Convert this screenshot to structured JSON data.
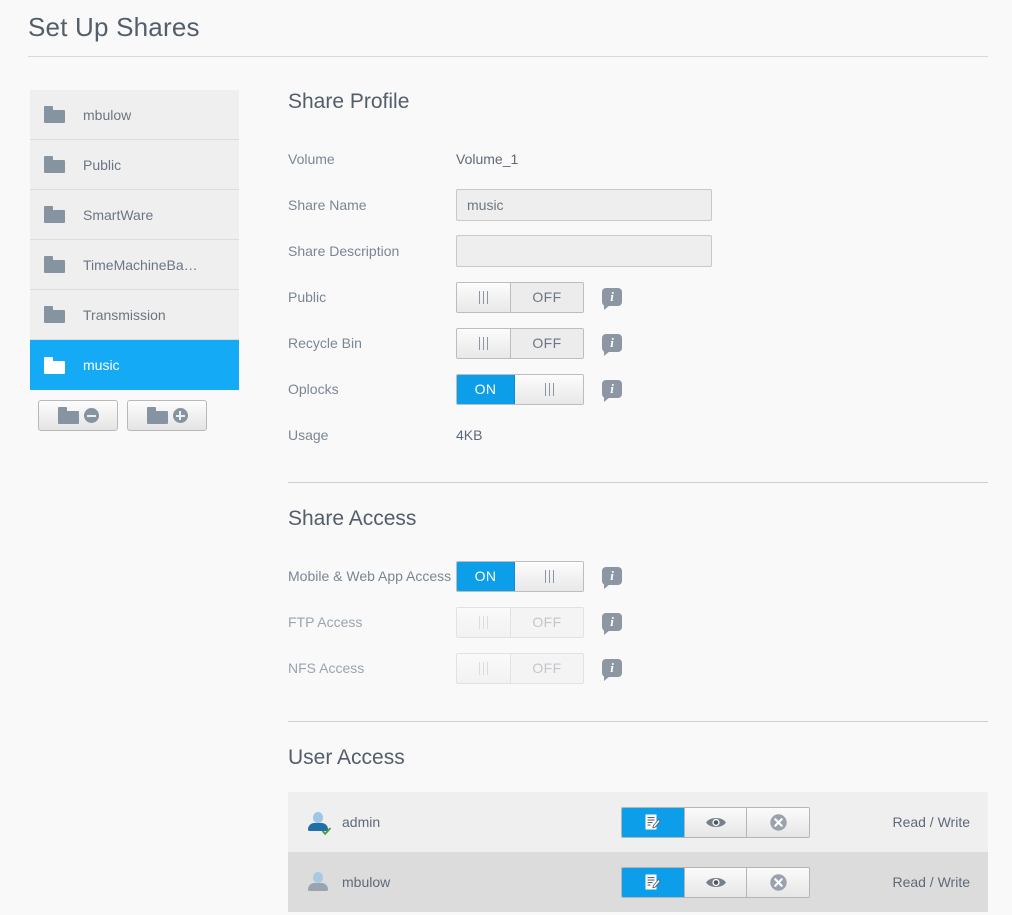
{
  "page": {
    "title": "Set Up Shares"
  },
  "sidebar": {
    "shares": [
      {
        "name": "mbulow",
        "selected": false
      },
      {
        "name": "Public",
        "selected": false
      },
      {
        "name": "SmartWare",
        "selected": false
      },
      {
        "name": "TimeMachineBa…",
        "selected": false
      },
      {
        "name": "Transmission",
        "selected": false
      },
      {
        "name": "music",
        "selected": true
      }
    ],
    "actions": {
      "remove_label": "remove-share",
      "add_label": "add-share"
    }
  },
  "share_profile": {
    "heading": "Share Profile",
    "volume": {
      "label": "Volume",
      "value": "Volume_1"
    },
    "share_name": {
      "label": "Share Name",
      "value": "music",
      "placeholder": ""
    },
    "share_description": {
      "label": "Share Description",
      "value": "",
      "placeholder": ""
    },
    "public": {
      "label": "Public",
      "state": "OFF",
      "off_text": "OFF"
    },
    "recycle_bin": {
      "label": "Recycle Bin",
      "state": "OFF",
      "off_text": "OFF"
    },
    "oplocks": {
      "label": "Oplocks",
      "state": "ON",
      "on_text": "ON"
    },
    "usage": {
      "label": "Usage",
      "value": "4KB"
    },
    "info_glyph": "i"
  },
  "share_access": {
    "heading": "Share Access",
    "rows": [
      {
        "label": "Mobile & Web App Access",
        "state": "ON",
        "text": "ON",
        "disabled": false
      },
      {
        "label": "FTP Access",
        "state": "OFF",
        "text": "OFF",
        "disabled": true
      },
      {
        "label": "NFS Access",
        "state": "OFF",
        "text": "OFF",
        "disabled": true
      }
    ]
  },
  "user_access": {
    "heading": "User Access",
    "users": [
      {
        "name": "admin",
        "permission": "Read / Write",
        "active_segment": "write",
        "verified": true
      },
      {
        "name": "mbulow",
        "permission": "Read / Write",
        "active_segment": "write",
        "verified": false
      }
    ]
  },
  "colors": {
    "accent_blue": "#0c9ee8",
    "selected_blue": "#14aaf5",
    "page_bg": "#f9f9f9",
    "row_light": "#efefef",
    "row_dark": "#dcdcdc",
    "text_heading": "#545e6b",
    "text_label": "#7b8694",
    "icon_grey": "#8594a0",
    "check_green": "#4f9d3a"
  }
}
